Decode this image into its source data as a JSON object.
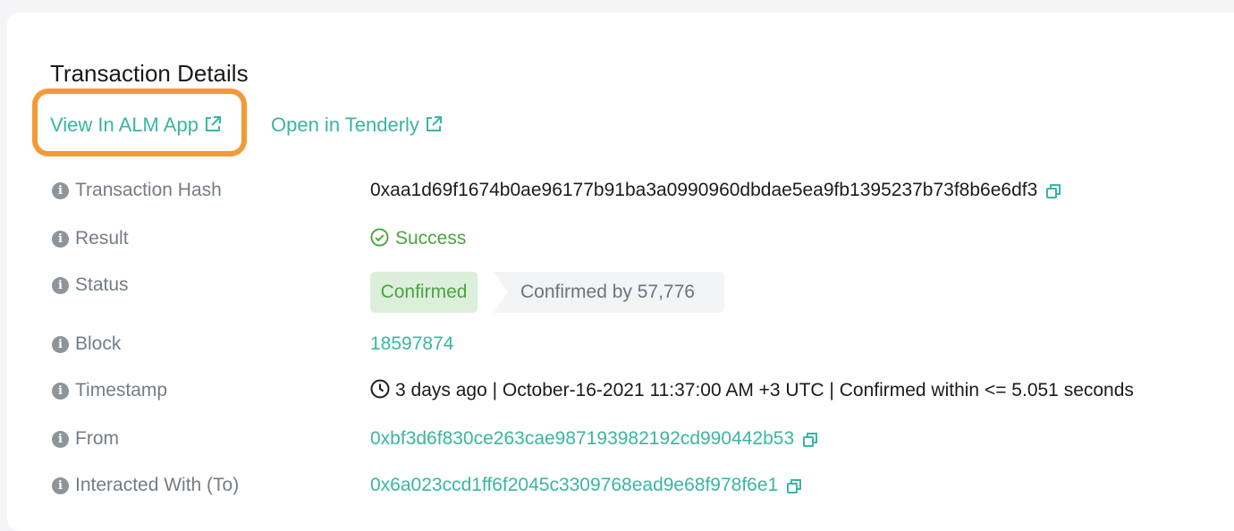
{
  "header": {
    "title": "Transaction Details"
  },
  "links": {
    "alm_label": "View In ALM App",
    "tenderly_label": "Open in Tenderly"
  },
  "colors": {
    "accent": "#3ab5a2",
    "success": "#4aa541",
    "highlight": "#f29a38"
  },
  "rows": {
    "tx_hash": {
      "label": "Transaction Hash",
      "value": "0xaa1d69f1674b0ae96177b91ba3a0990960dbdae5ea9fb1395237b73f8b6e6df3"
    },
    "result": {
      "label": "Result",
      "value": "Success"
    },
    "status": {
      "label": "Status",
      "badge": "Confirmed",
      "confirmations": "Confirmed by 57,776"
    },
    "block": {
      "label": "Block",
      "value": "18597874"
    },
    "timestamp": {
      "label": "Timestamp",
      "value": "3 days ago | October-16-2021 11:37:00 AM +3 UTC | Confirmed within <= 5.051 seconds"
    },
    "from": {
      "label": "From",
      "value": "0xbf3d6f830ce263cae987193982192cd990442b53"
    },
    "to": {
      "label": "Interacted With (To)",
      "value": "0x6a023ccd1ff6f2045c3309768ead9e68f978f6e1"
    }
  },
  "icons": {
    "info": "info-icon",
    "copy": "copy-icon",
    "external": "external-link-icon",
    "check": "check-circle-icon",
    "clock": "clock-icon"
  }
}
